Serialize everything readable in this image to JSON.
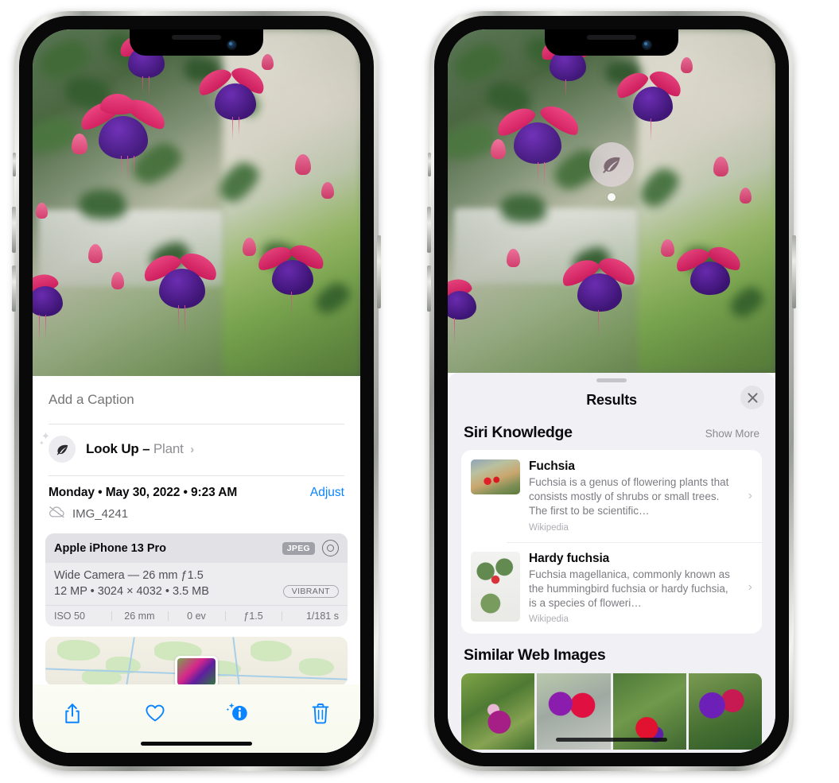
{
  "phone_left": {
    "photo_alt": "fuchsia-flowers-photo",
    "caption": {
      "placeholder": "Add a Caption",
      "value": ""
    },
    "lookup": {
      "label": "Look Up –",
      "subject": "Plant",
      "icon": "leaf-icon",
      "chevron": "›"
    },
    "meta": {
      "date": "Monday • May 30, 2022 • 9:23 AM",
      "adjust_label": "Adjust",
      "filename": "IMG_4241",
      "cloud_icon": "cloud-slash-icon"
    },
    "camera_card": {
      "device": "Apple iPhone 13 Pro",
      "format_chip": "JPEG",
      "raw_icon": "raw-circle-icon",
      "lens_line": "Wide Camera — 26 mm ƒ1.5",
      "specs_line": "12 MP • 3024 × 4032 • 3.5 MB",
      "style_chip": "VIBRANT",
      "exif": [
        "ISO 50",
        "26 mm",
        "0 ev",
        "ƒ1.5",
        "1/181 s"
      ]
    },
    "map": {
      "name": "location-map-thumbnail"
    },
    "toolbar": [
      {
        "name": "share-button",
        "icon": "share-icon"
      },
      {
        "name": "favorite-button",
        "icon": "heart-icon"
      },
      {
        "name": "info-button",
        "icon": "info-sparkle-icon"
      },
      {
        "name": "delete-button",
        "icon": "trash-icon"
      }
    ],
    "accent_color": "#0a84ff"
  },
  "phone_right": {
    "photo_alt": "fuchsia-flowers-photo",
    "lookup_badge": {
      "icon": "leaf-icon"
    },
    "sheet": {
      "title": "Results",
      "close_label": "✕",
      "sections": [
        {
          "name": "siri-knowledge",
          "title": "Siri Knowledge",
          "action": "Show More",
          "items": [
            {
              "title": "Fuchsia",
              "description": "Fuchsia is a genus of flowering plants that consists mostly of shrubs or small trees. The first to be scientific…",
              "source": "Wikipedia",
              "chevron": "›"
            },
            {
              "title": "Hardy fuchsia",
              "description": "Fuchsia magellanica, commonly known as the hummingbird fuchsia or hardy fuchsia, is a species of floweri…",
              "source": "Wikipedia",
              "chevron": "›"
            }
          ]
        },
        {
          "name": "similar-web-images",
          "title": "Similar Web Images",
          "thumbnails": [
            "web-image-1",
            "web-image-2",
            "web-image-3",
            "web-image-4"
          ]
        }
      ]
    }
  },
  "colors": {
    "accent": "#0a84ff",
    "sheet_bg": "#f1f1f5",
    "card_bg": "#ffffff",
    "secondary_text": "#8e8e93"
  }
}
